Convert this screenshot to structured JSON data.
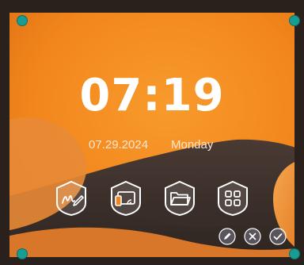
{
  "clock": {
    "time": "07:19",
    "date": "07.29.2024",
    "weekday": "Monday"
  },
  "apps": [
    {
      "icon": "whiteboard-pen-icon"
    },
    {
      "icon": "screen-cast-icon"
    },
    {
      "icon": "folder-icon"
    },
    {
      "icon": "apps-grid-icon"
    }
  ],
  "controls": [
    {
      "icon": "edit-pencil-icon"
    },
    {
      "icon": "close-x-icon"
    },
    {
      "icon": "confirm-check-icon"
    }
  ],
  "colors": {
    "accent": "#f28c1d",
    "handle": "#179d93",
    "frame": "#2a211c"
  }
}
